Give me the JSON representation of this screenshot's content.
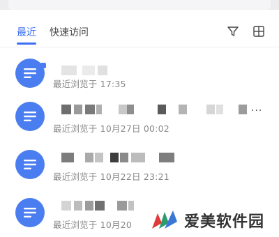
{
  "tabs": [
    {
      "label": "最近",
      "active": true
    },
    {
      "label": "快速访问",
      "active": false
    }
  ],
  "toolbar": {
    "filter_icon": "filter-icon",
    "grid_icon": "grid-view-icon"
  },
  "items": [
    {
      "meta": "最近浏览于 17:35"
    },
    {
      "meta": "最近浏览于 10月27日 00:02",
      "more": "..."
    },
    {
      "meta": "最近浏览于 10月22日 23:21"
    },
    {
      "meta": "最近浏览于 10月20"
    }
  ],
  "watermark": {
    "text": "爱美软件园"
  },
  "colors": {
    "accent": "#3b6ef5",
    "doc_icon": "#4a7df0"
  }
}
